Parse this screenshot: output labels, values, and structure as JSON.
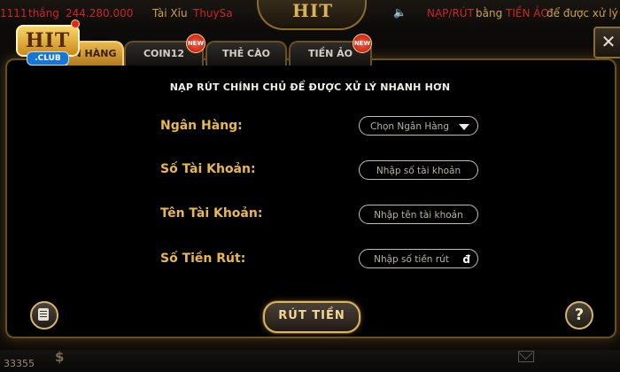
{
  "background": {
    "ticker_left_number": "1111",
    "ticker_left_word": "thắng",
    "ticker_amount": "244.280.000",
    "ticker_game": "Tài Xỉu",
    "ticker_user": "ThuySa",
    "ticker_right_label": "NẠP/RÚT",
    "ticker_right_mid": "bằng",
    "ticker_right_highlight": "TIỀN ẢO",
    "ticker_right_tail": "để được xử lý",
    "hub_logo": "HIT",
    "bottom_number": "33355",
    "bottom_currency": "$"
  },
  "logo": {
    "main": "HIT",
    "sub": ".CLUB"
  },
  "tabs": [
    {
      "label": "N HÀNG",
      "active": true,
      "badge": ""
    },
    {
      "label": "COIN12",
      "active": false,
      "badge": "NEW"
    },
    {
      "label": "THẺ CÀO",
      "active": false,
      "badge": ""
    },
    {
      "label": "TIỀN ẢO",
      "active": false,
      "badge": "NEW"
    }
  ],
  "close_label": "✕",
  "form": {
    "headline": "NẠP RÚT CHÍNH CHỦ ĐỂ ĐƯỢC XỬ LÝ NHANH HƠN",
    "bank_label": "Ngân Hàng:",
    "bank_select": "Chọn Ngân Hàng",
    "account_number_label": "Số Tài Khoản:",
    "account_number_placeholder": "Nhập số tài  khoản",
    "account_name_label": "Tên Tài Khoản:",
    "account_name_placeholder": "Nhập tên tài khoản",
    "amount_label": "Số Tiền Rút:",
    "amount_placeholder": "Nhập số tiền rút",
    "currency_symbol": "đ"
  },
  "submit_label": "RÚT TIỀN",
  "help_label": "?"
}
